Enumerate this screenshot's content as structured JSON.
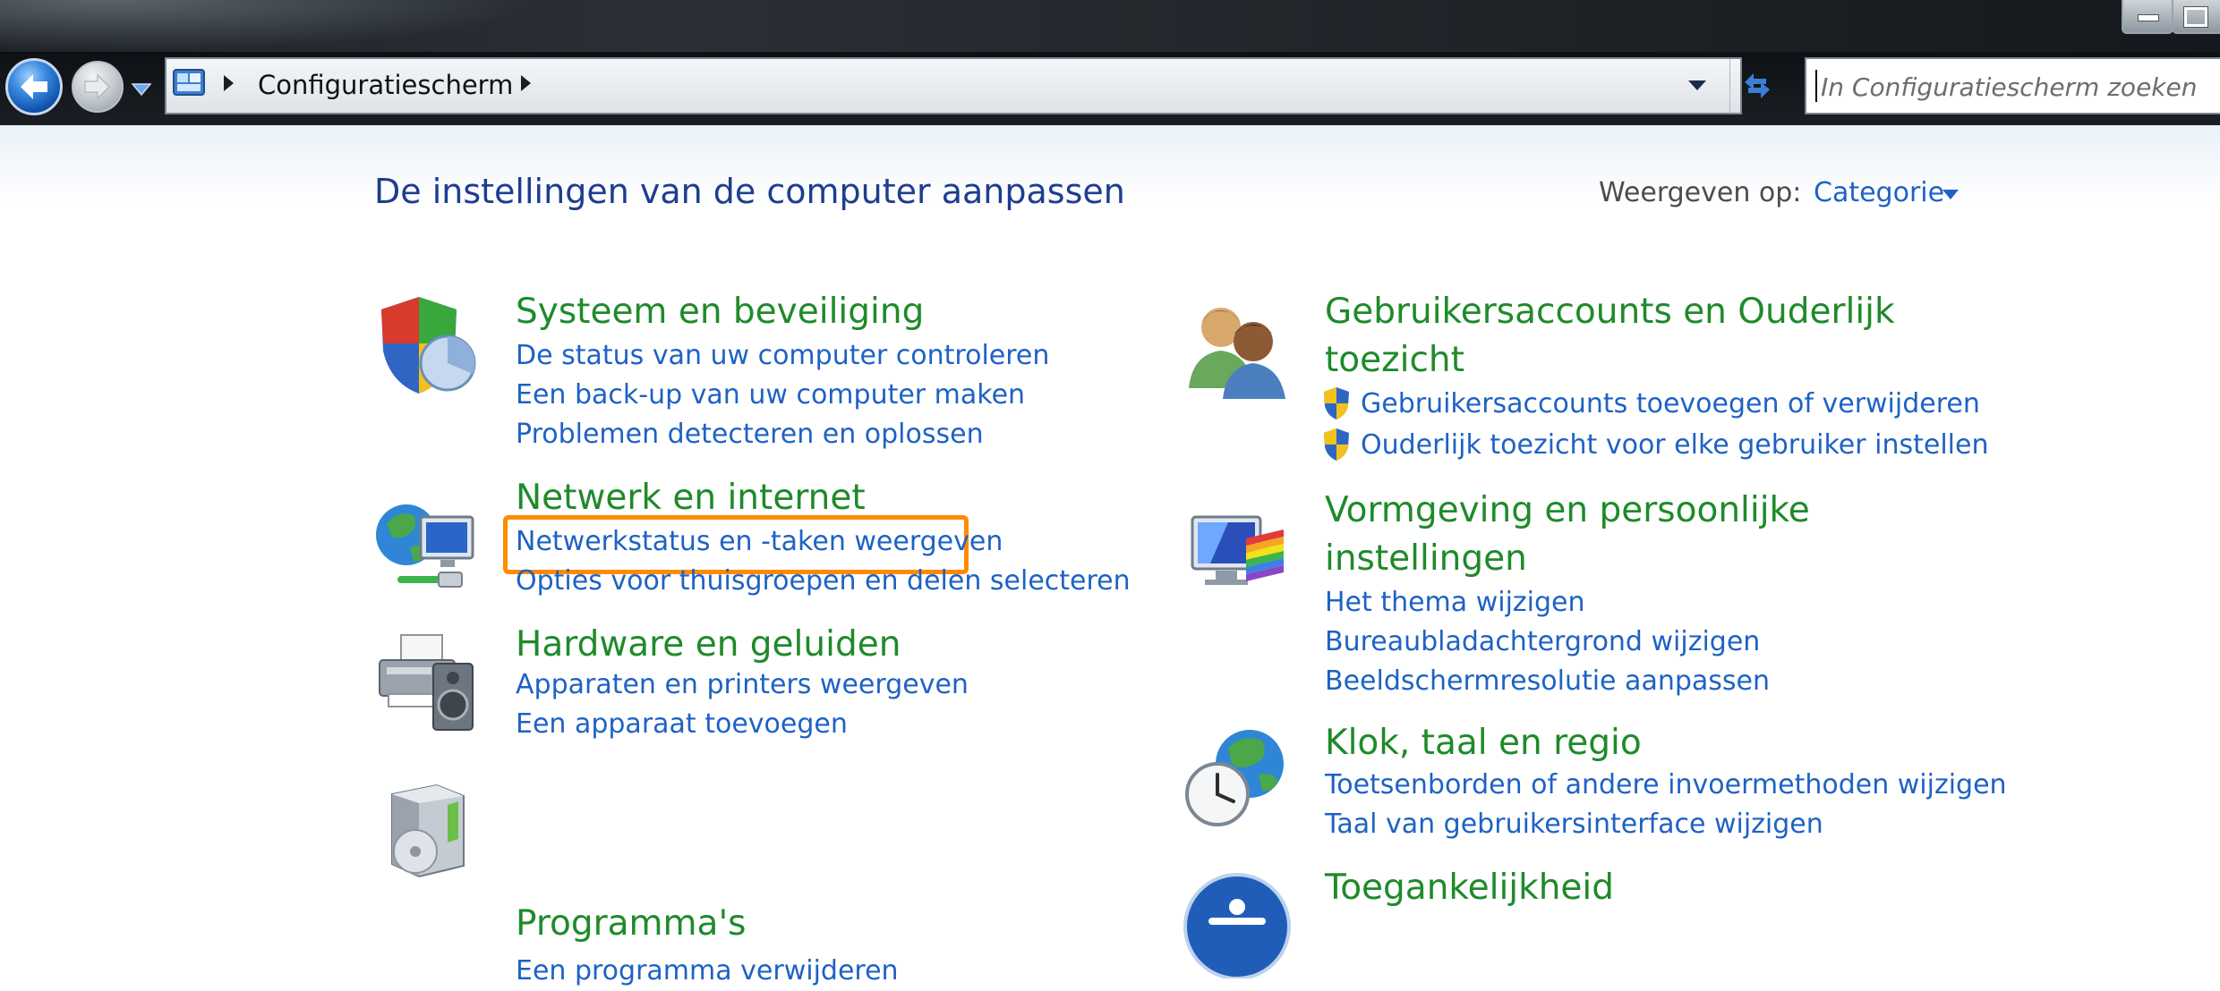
{
  "address_bar": {
    "breadcrumb": "Configuratiescherm",
    "search_placeholder": "In Configuratiescherm zoeken"
  },
  "header": {
    "title": "De instellingen van de computer aanpassen",
    "view_label": "Weergeven op:",
    "view_value": "Categorie"
  },
  "categories_left": [
    {
      "title": "Systeem en beveiliging",
      "links": [
        "De status van uw computer controleren",
        "Een back-up van uw computer maken",
        "Problemen detecteren en oplossen"
      ]
    },
    {
      "title": "Netwerk en internet",
      "links": [
        "Netwerkstatus en -taken weergeven",
        "Opties voor thuisgroepen en delen selecteren"
      ]
    },
    {
      "title": "Hardware en geluiden",
      "links": [
        "Apparaten en printers weergeven",
        "Een apparaat toevoegen"
      ]
    },
    {
      "title": "Programma's",
      "links": [
        "Een programma verwijderen"
      ]
    }
  ],
  "categories_right": [
    {
      "title_line1": "Gebruikersaccounts en Ouderlijk",
      "title_line2": "toezicht",
      "links": [
        "Gebruikersaccounts toevoegen of verwijderen",
        "Ouderlijk toezicht voor elke gebruiker instellen"
      ]
    },
    {
      "title_line1": "Vormgeving en persoonlijke",
      "title_line2": "instellingen",
      "links": [
        "Het thema wijzigen",
        "Bureaubladachtergrond wijzigen",
        "Beeldschermresolutie aanpassen"
      ]
    },
    {
      "title": "Klok, taal en regio",
      "links": [
        "Toetsenborden of andere invoermethoden wijzigen",
        "Taal van gebruikersinterface wijzigen"
      ]
    },
    {
      "title": "Toegankelijkheid"
    }
  ],
  "colors": {
    "category_title": "#1f8a2a",
    "link": "#1e62c4",
    "page_title": "#1e3d8f",
    "highlight": "#ff8a00"
  }
}
